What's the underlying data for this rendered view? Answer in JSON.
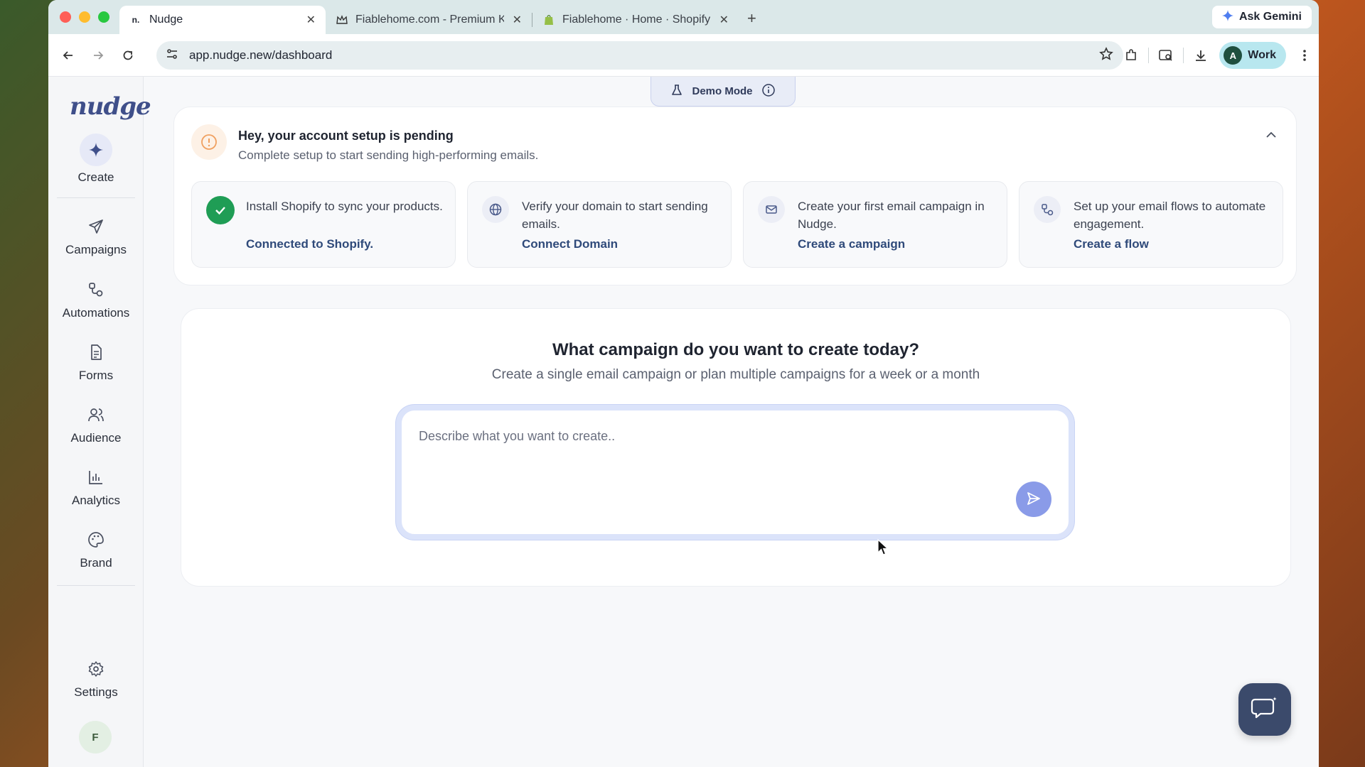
{
  "browser": {
    "tabs": [
      {
        "title": "Nudge",
        "favicon": "n."
      },
      {
        "title": "Fiablehome.com - Premium K"
      },
      {
        "title": "Fiablehome · Home · Shopify"
      }
    ],
    "ask_gemini": "Ask Gemini",
    "url": "app.nudge.new/dashboard",
    "profile_initial": "A",
    "profile_name": "Work"
  },
  "sidebar": {
    "logo": "nudge",
    "create_label": "Create",
    "items": [
      {
        "label": "Campaigns"
      },
      {
        "label": "Automations"
      },
      {
        "label": "Forms"
      },
      {
        "label": "Audience"
      },
      {
        "label": "Analytics"
      },
      {
        "label": "Brand"
      }
    ],
    "settings_label": "Settings",
    "user_initial": "F"
  },
  "demo_mode": "Demo Mode",
  "setup": {
    "title": "Hey, your account setup is pending",
    "subtitle": "Complete setup to start sending high-performing emails.",
    "steps": [
      {
        "text": "Install Shopify to sync your products.",
        "link": "Connected to Shopify.",
        "icon": "check-icon"
      },
      {
        "text": "Verify your domain to start sending emails.",
        "link": "Connect Domain",
        "icon": "globe-icon"
      },
      {
        "text": "Create your first email campaign in Nudge.",
        "link": "Create a campaign",
        "icon": "mail-icon"
      },
      {
        "text": "Set up your email flows to automate engagement.",
        "link": "Create a flow",
        "icon": "flow-icon"
      }
    ]
  },
  "campaign": {
    "title": "What campaign do you want to create today?",
    "subtitle": "Create a single email campaign or plan multiple campaigns for a week or a month",
    "placeholder": "Describe what you want to create.."
  },
  "colors": {
    "accent": "#8a9be8",
    "success": "#1f9d55",
    "link": "#2f4a7a"
  }
}
